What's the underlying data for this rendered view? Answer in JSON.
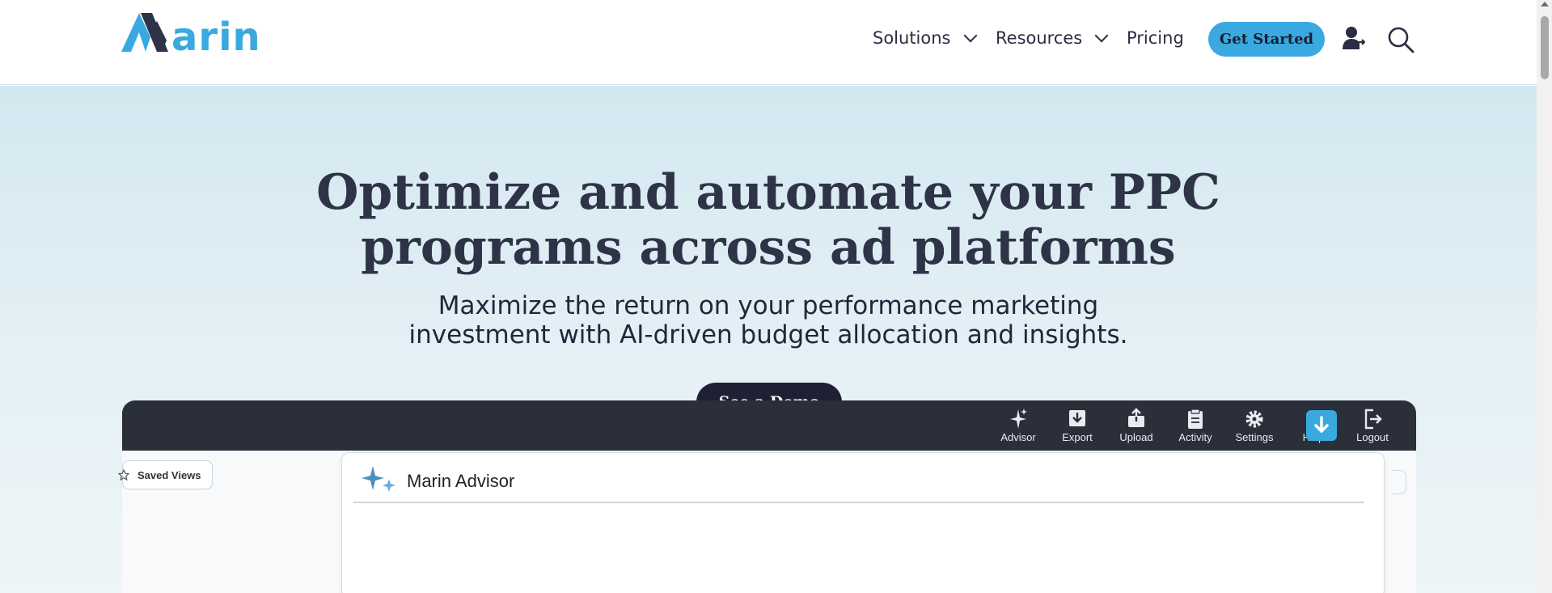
{
  "brand": {
    "logo_text": "arin",
    "accent": "#3aa9e0",
    "dark": "#1f2033"
  },
  "nav": {
    "solutions": "Solutions",
    "resources": "Resources",
    "pricing": "Pricing",
    "get_started": "Get Started"
  },
  "hero": {
    "title_line1": "Optimize and automate your PPC",
    "title_line2": "programs across ad platforms",
    "subtitle_line1": "Maximize the return on your performance marketing",
    "subtitle_line2": "investment with AI-driven budget allocation and insights.",
    "cta": "See a Demo"
  },
  "preview": {
    "toolbar": [
      {
        "label": "Advisor",
        "icon": "sparkle-icon"
      },
      {
        "label": "Export",
        "icon": "export-icon"
      },
      {
        "label": "Upload",
        "icon": "upload-icon"
      },
      {
        "label": "Activity",
        "icon": "clipboard-icon"
      },
      {
        "label": "Settings",
        "icon": "gear-icon"
      },
      {
        "label": "Help",
        "icon": "help-icon"
      },
      {
        "label": "Logout",
        "icon": "logout-icon"
      }
    ],
    "saved_views": "Saved Views",
    "advisor_title": "Marin Advisor"
  }
}
